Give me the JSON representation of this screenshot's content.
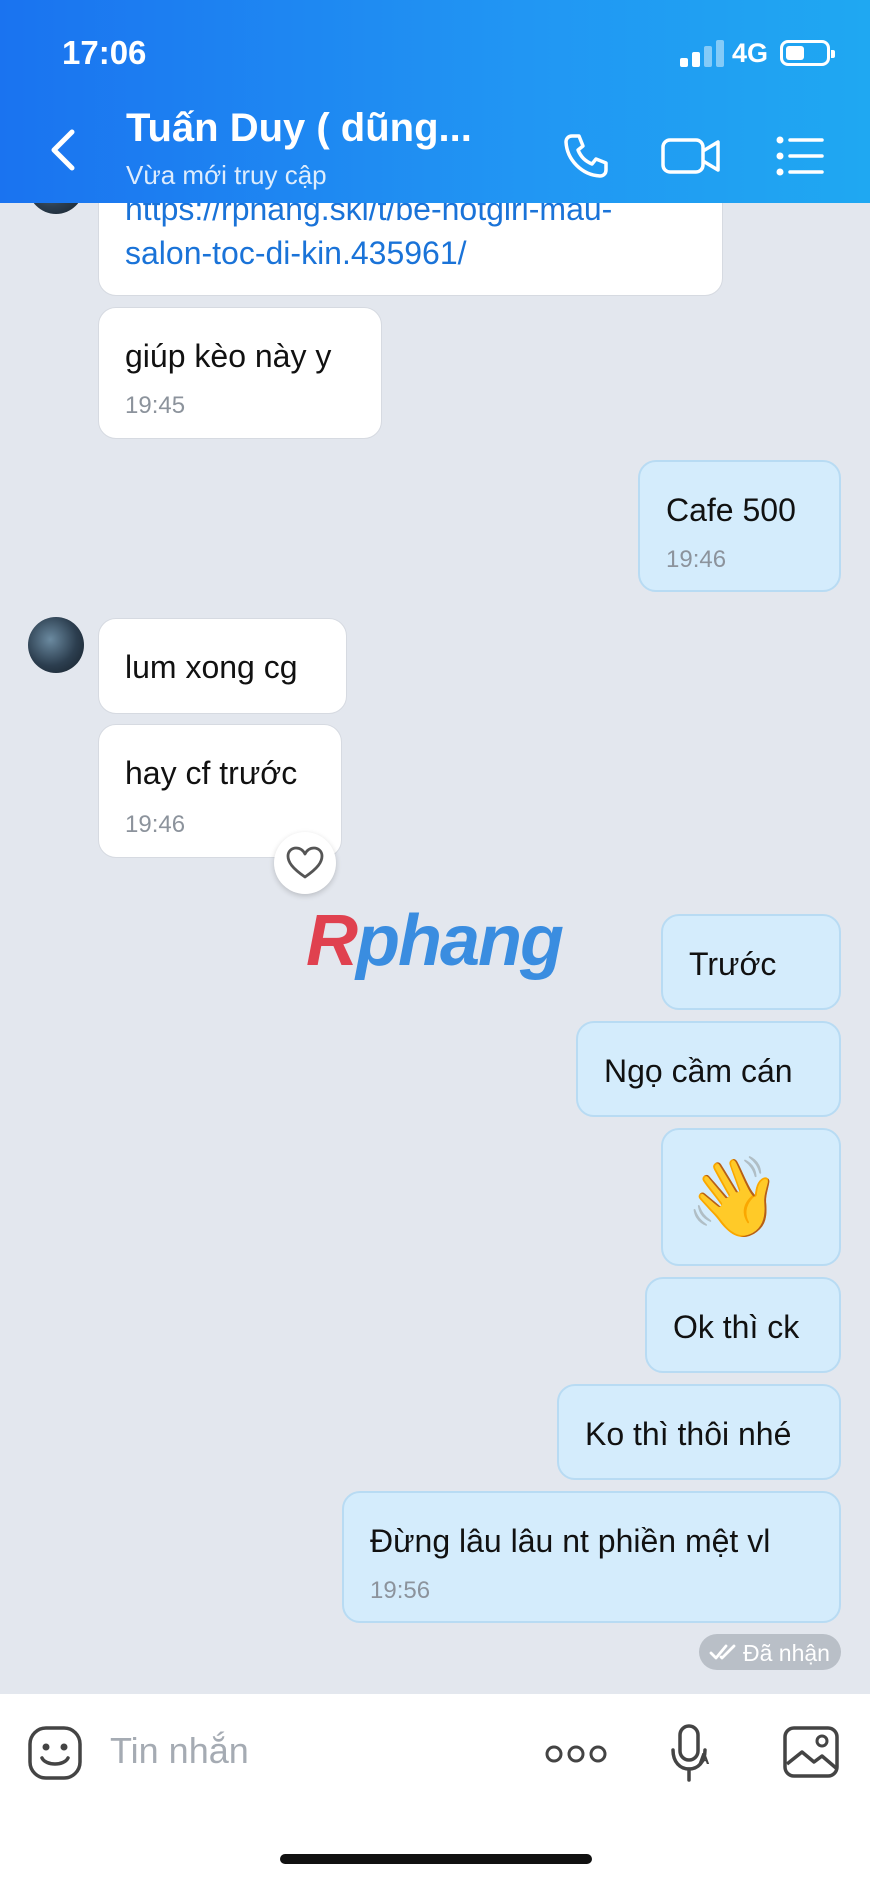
{
  "status": {
    "time": "17:06",
    "network": "4G"
  },
  "header": {
    "title": "Tuấn Duy ( dũng...",
    "subtitle": "Vừa mới truy cập"
  },
  "messages": {
    "link_line1": "https://rphang.ski/t/be-hotgirl-mau-",
    "link_line2": "salon-toc-di-kin.435961/",
    "m1": {
      "text": "giúp kèo này y",
      "time": "19:45"
    },
    "m2": {
      "text": "Cafe 500",
      "time": "19:46"
    },
    "m3": {
      "text": "lum xong cg"
    },
    "m4": {
      "text": "hay cf trước",
      "time": "19:46"
    },
    "m5": {
      "text": "Trước"
    },
    "m6": {
      "text": "Ngọ cầm cán"
    },
    "m7": {
      "emoji": "👋"
    },
    "m8": {
      "text": "Ok thì ck"
    },
    "m9": {
      "text": "Ko thì thôi nhé"
    },
    "m10": {
      "text": "Đừng lâu lâu nt phiền mệt vl",
      "time": "19:56"
    },
    "received_label": "Đã nhận"
  },
  "watermark": {
    "first": "R",
    "rest": "phang"
  },
  "input": {
    "placeholder": "Tin nhắn"
  },
  "icons": {
    "back": "chevron-left-icon",
    "call": "phone-icon",
    "video": "video-camera-icon",
    "menu": "list-menu-icon",
    "emoji": "emoji-face-icon",
    "more": "more-dots-icon",
    "mic": "microphone-icon",
    "image": "image-icon",
    "react": "heart-icon"
  },
  "colors": {
    "header": "#1a73f0",
    "outgoing": "#d4ecfc",
    "incoming": "#ffffff",
    "link": "#1a73d8"
  }
}
